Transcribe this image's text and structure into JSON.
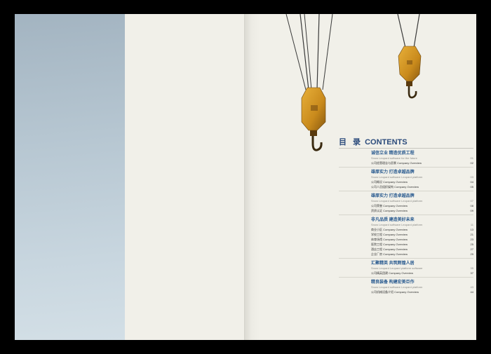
{
  "toc": {
    "title_cn": "目 录",
    "title_en": "CONTENTS",
    "sections": [
      {
        "title": "诚信立业  精造优质工程",
        "subtitle": "Snow Leopard software for the future",
        "subtitle_page": "01",
        "entries": [
          {
            "text": "公司经营理念与愿景   Company Overview",
            "page": "02"
          }
        ]
      },
      {
        "title": "雄厚实力  打造卓越品牌",
        "subtitle": "Snow Leopard software Leopard platform",
        "subtitle_page": "03",
        "entries": [
          {
            "text": "公司概况   Company Overview",
            "page": "04"
          },
          {
            "text": "公司人员组织架构   Company Overview",
            "page": "05"
          }
        ]
      },
      {
        "title": "雄厚实力  打造卓越品牌",
        "subtitle": "Snow Leopard software Leopard platform",
        "subtitle_page": "07",
        "entries": [
          {
            "text": "公司荣誉   Company Overview",
            "page": "08"
          },
          {
            "text": "资质认证   Company Overview",
            "page": "09"
          }
        ]
      },
      {
        "title": "非凡品质  建造美好未来",
        "subtitle": "Snow Leopard software Leopard platform",
        "subtitle_page": "11",
        "entries": [
          {
            "text": "商业小区   Company Overview",
            "page": "13"
          },
          {
            "text": "学校工程   Company Overview",
            "page": "21"
          },
          {
            "text": "体育场馆   Company Overview",
            "page": "23"
          },
          {
            "text": "医院工程   Company Overview",
            "page": "25"
          },
          {
            "text": "酒店工程   Company Overview",
            "page": "27"
          },
          {
            "text": "企业厂房   Company Overview",
            "page": "29"
          }
        ]
      },
      {
        "title": "汇聚精英  共筑辉煌人居",
        "subtitle": "Snow Leopard Leopard platform software",
        "subtitle_page": "35",
        "entries": [
          {
            "text": "公司精英团建   Company Overview",
            "page": "37"
          }
        ]
      },
      {
        "title": "精良装备  构建宏美巨作",
        "subtitle": "Snow Leopard software Leopard platform",
        "subtitle_page": "43",
        "entries": [
          {
            "text": "公司机械设备介绍   Company Overview",
            "page": "44"
          }
        ]
      }
    ]
  },
  "colors": {
    "accent_blue": "#2a4a7b",
    "section_blue": "#2a5b90",
    "hook_yellow": "#d89a22",
    "page_bg": "#f1f0e9",
    "panel_blue": "#b7c7d2"
  }
}
